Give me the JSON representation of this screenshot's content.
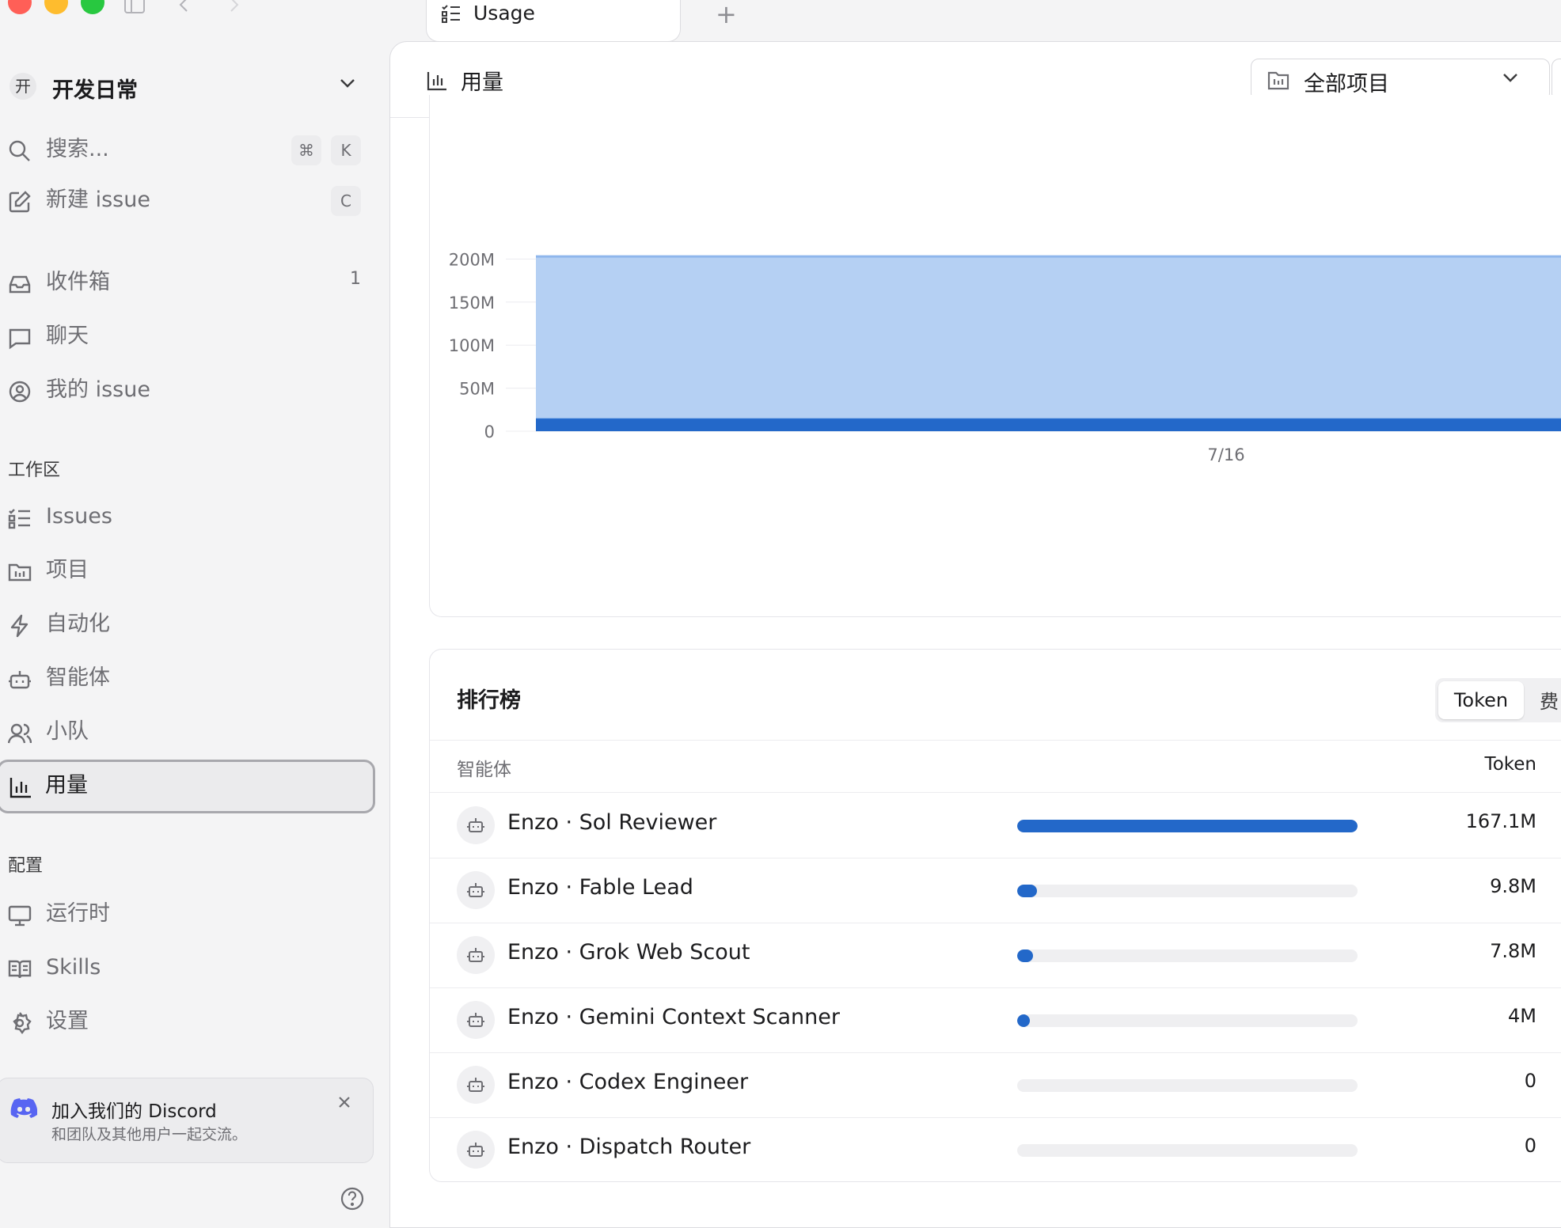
{
  "tab": {
    "label": "Usage",
    "new_tab": "+"
  },
  "workspace": {
    "badge": "开",
    "name": "开发日常"
  },
  "sidebar": {
    "search": {
      "label": "搜索...",
      "shortcut_mod": "⌘",
      "shortcut_key": "K"
    },
    "new_issue": {
      "label": "新建 issue",
      "shortcut": "C"
    },
    "inbox": {
      "label": "收件箱",
      "count": "1"
    },
    "chat": {
      "label": "聊天"
    },
    "my_issues": {
      "label": "我的 issue"
    },
    "workspace_section": "工作区",
    "items": [
      {
        "label": "Issues",
        "icon": "list-icon"
      },
      {
        "label": "项目",
        "icon": "folder-chart-icon"
      },
      {
        "label": "自动化",
        "icon": "lightning-icon"
      },
      {
        "label": "智能体",
        "icon": "robot-icon"
      },
      {
        "label": "小队",
        "icon": "users-icon"
      },
      {
        "label": "用量",
        "icon": "bar-chart-icon",
        "active": true
      }
    ],
    "config_section": "配置",
    "config_items": [
      {
        "label": "运行时",
        "icon": "monitor-icon"
      },
      {
        "label": "Skills",
        "icon": "book-icon"
      },
      {
        "label": "设置",
        "icon": "gear-icon"
      }
    ],
    "discord": {
      "title": "加入我们的 Discord",
      "subtitle": "和团队及其他用户一起交流。"
    }
  },
  "header": {
    "title": "用量",
    "project_filter": "全部项目"
  },
  "chart_data": {
    "type": "area",
    "x_ticks": [
      "7/16"
    ],
    "y_ticks": [
      "0",
      "50M",
      "100M",
      "150M",
      "200M"
    ],
    "ylim": [
      0,
      200
    ],
    "unit": "M",
    "series": [
      {
        "values": [
          15
        ],
        "color": "#2368c9"
      },
      {
        "values": [
          188
        ],
        "color": "#b5d0f3"
      }
    ]
  },
  "leaderboard": {
    "title": "排行榜",
    "toggle": {
      "active": "Token",
      "inactive": "费"
    },
    "col_agent": "智能体",
    "col_token": "Token",
    "rows": [
      {
        "name": "Enzo · Sol Reviewer",
        "value": "167.1M",
        "share": 1.0
      },
      {
        "name": "Enzo · Fable Lead",
        "value": "9.8M",
        "share": 0.059
      },
      {
        "name": "Enzo · Grok Web Scout",
        "value": "7.8M",
        "share": 0.047
      },
      {
        "name": "Enzo · Gemini Context Scanner",
        "value": "4M",
        "share": 0.024
      },
      {
        "name": "Enzo · Codex Engineer",
        "value": "0",
        "share": 0
      },
      {
        "name": "Enzo · Dispatch Router",
        "value": "0",
        "share": 0
      }
    ]
  },
  "colors": {
    "accent": "#2368c9",
    "accent_light": "#b5d0f3",
    "discord": "#5865f2"
  }
}
